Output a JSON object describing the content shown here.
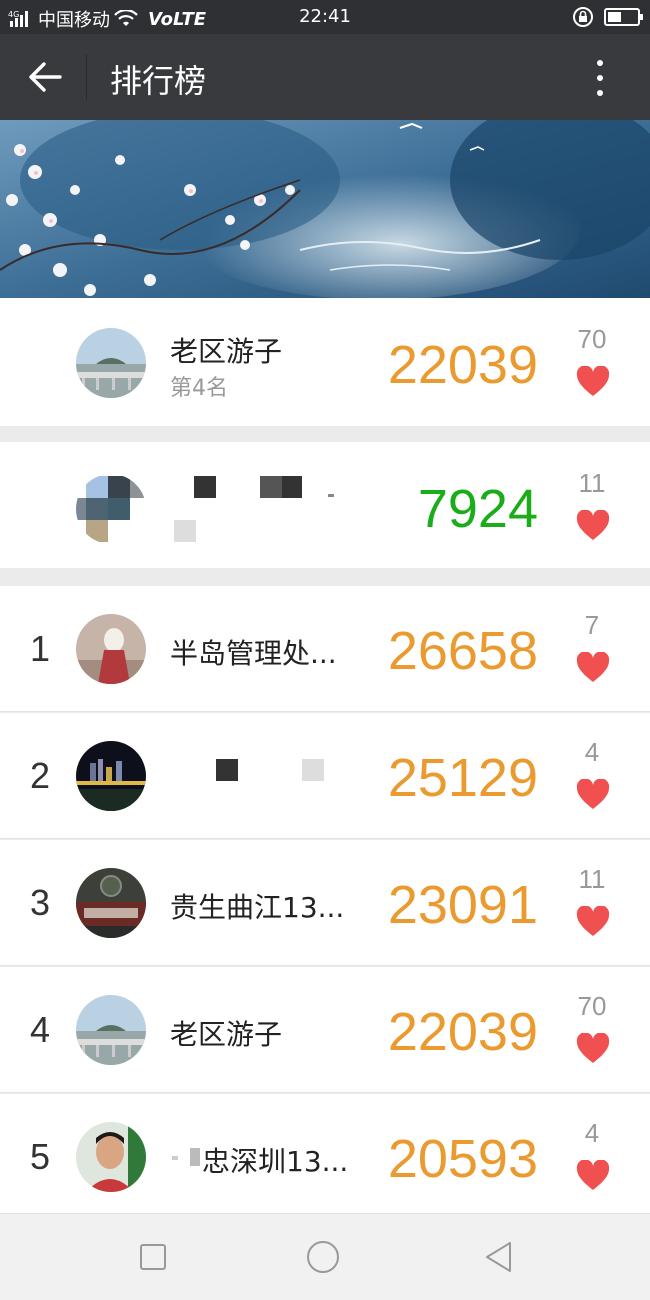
{
  "status_bar": {
    "network": "4G",
    "carrier": "中国移动",
    "volte": "VoLTE",
    "time": "22:41",
    "battery_level": 0.45
  },
  "app_bar": {
    "title": "排行榜"
  },
  "my_record": {
    "name": "老区游子",
    "rank_text": "第4名",
    "steps": "22039",
    "likes": "70"
  },
  "second_record": {
    "steps": "7924",
    "likes": "11"
  },
  "leaderboard": [
    {
      "rank": "1",
      "name": "半岛管理处...",
      "steps": "26658",
      "likes": "7"
    },
    {
      "rank": "2",
      "name": "",
      "steps": "25129",
      "likes": "4"
    },
    {
      "rank": "3",
      "name": "贵生曲江13...",
      "steps": "23091",
      "likes": "11"
    },
    {
      "rank": "4",
      "name": "老区游子",
      "steps": "22039",
      "likes": "70"
    },
    {
      "rank": "5",
      "name": "忠深圳13...",
      "steps": "20593",
      "likes": "4"
    }
  ],
  "colors": {
    "top_bar": "#383a3e",
    "steps_orange": "#ea9a2f",
    "steps_green": "#1aad19",
    "heart": "#f05050"
  }
}
